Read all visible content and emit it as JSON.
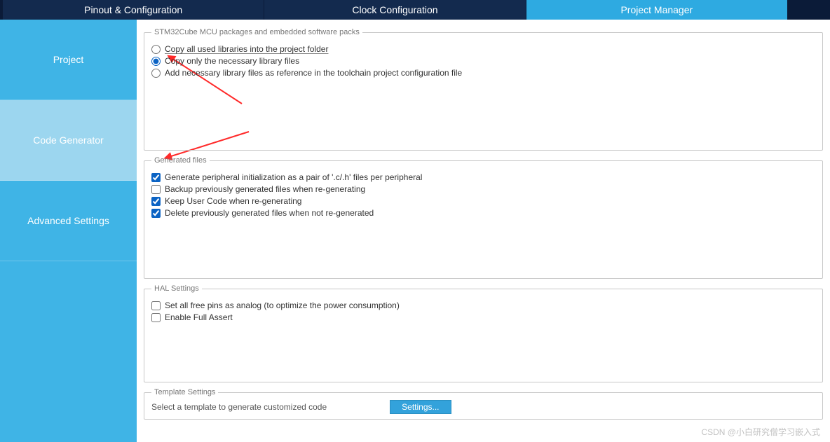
{
  "tabs": {
    "pinout": "Pinout & Configuration",
    "clock": "Clock Configuration",
    "project": "Project Manager"
  },
  "sidebar": {
    "project": "Project",
    "code_generator": "Code Generator",
    "advanced": "Advanced Settings"
  },
  "group_packages": {
    "legend": "STM32Cube MCU packages and embedded software packs",
    "opt_copy_all": "Copy all used libraries into the project folder",
    "opt_copy_necessary": "Copy only the necessary library files",
    "opt_add_ref": "Add necessary library files as reference in the toolchain project configuration file"
  },
  "group_generated": {
    "legend": "Generated files",
    "chk_pair": "Generate peripheral initialization as a pair of '.c/.h' files per peripheral",
    "chk_backup": "Backup previously generated files when re-generating",
    "chk_keep": "Keep User Code when re-generating",
    "chk_delete": "Delete previously generated files when not re-generated"
  },
  "group_hal": {
    "legend": "HAL Settings",
    "chk_analog": "Set all free pins as analog (to optimize the power consumption)",
    "chk_assert": "Enable Full Assert"
  },
  "group_template": {
    "legend": "Template Settings",
    "desc": "Select a template to generate customized code",
    "btn": "Settings..."
  },
  "watermark": "CSDN @小白研究僧学习嵌入式"
}
